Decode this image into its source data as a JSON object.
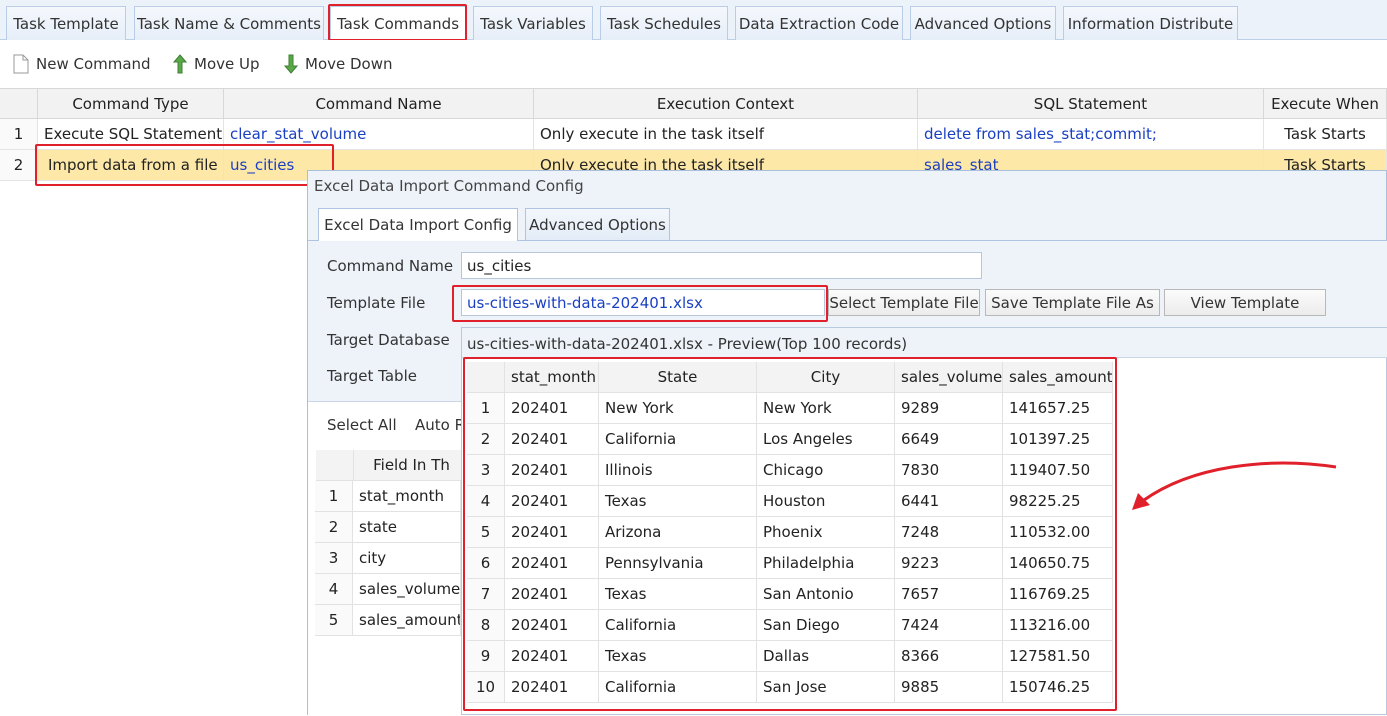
{
  "tabs": [
    {
      "label": "Task Template"
    },
    {
      "label": "Task Name & Comments"
    },
    {
      "label": "Task Commands"
    },
    {
      "label": "Task Variables"
    },
    {
      "label": "Task Schedules"
    },
    {
      "label": "Data Extraction Code"
    },
    {
      "label": "Advanced Options"
    },
    {
      "label": "Information Distribute"
    }
  ],
  "toolbar": {
    "new_command": "New Command",
    "move_up": "Move Up",
    "move_down": "Move Down"
  },
  "commands_grid": {
    "columns": [
      "Command Type",
      "Command Name",
      "Execution Context",
      "SQL Statement",
      "Execute When"
    ],
    "rows": [
      {
        "num": "1",
        "type": "Execute SQL Statements",
        "name": "clear_stat_volume",
        "context": "Only execute in the task itself",
        "sql": "delete from sales_stat;commit;",
        "when": "Task Starts"
      },
      {
        "num": "2",
        "type": "Import data from a file",
        "name": "us_cities",
        "context": "Only execute in the task itself",
        "sql": "sales_stat",
        "when": "Task Starts"
      }
    ]
  },
  "dialog": {
    "title": "Excel Data Import Command Config",
    "tabs": [
      "Excel Data Import Config",
      "Advanced Options"
    ],
    "command_name_label": "Command Name",
    "command_name_value": "us_cities",
    "template_file_label": "Template File",
    "template_file_value": "us-cities-with-data-202401.xlsx",
    "select_template_button": "Select Template File",
    "save_template_button": "Save Template File As",
    "view_template_button": "View Template",
    "target_database_label": "Target Database",
    "target_table_label": "Target Table",
    "select_all": "Select All",
    "auto_partial": "Auto R",
    "field_header_partial": "Field In Th",
    "fields": [
      {
        "num": "1",
        "name": "stat_month"
      },
      {
        "num": "2",
        "name": "state"
      },
      {
        "num": "3",
        "name": "city"
      },
      {
        "num": "4",
        "name": "sales_volume"
      },
      {
        "num": "5",
        "name": "sales_amount"
      }
    ]
  },
  "preview": {
    "title": "us-cities-with-data-202401.xlsx - Preview(Top 100 records)",
    "columns": [
      "stat_month",
      "State",
      "City",
      "sales_volume",
      "sales_amount"
    ],
    "rows": [
      [
        "1",
        "202401",
        "New York",
        "New York",
        "9289",
        "141657.25"
      ],
      [
        "2",
        "202401",
        "California",
        "Los Angeles",
        "6649",
        "101397.25"
      ],
      [
        "3",
        "202401",
        "Illinois",
        "Chicago",
        "7830",
        "119407.50"
      ],
      [
        "4",
        "202401",
        "Texas",
        "Houston",
        "6441",
        "98225.25"
      ],
      [
        "5",
        "202401",
        "Arizona",
        "Phoenix",
        "7248",
        "110532.00"
      ],
      [
        "6",
        "202401",
        "Pennsylvania",
        "Philadelphia",
        "9223",
        "140650.75"
      ],
      [
        "7",
        "202401",
        "Texas",
        "San Antonio",
        "7657",
        "116769.25"
      ],
      [
        "8",
        "202401",
        "California",
        "San Diego",
        "7424",
        "113216.00"
      ],
      [
        "9",
        "202401",
        "Texas",
        "Dallas",
        "8366",
        "127581.50"
      ],
      [
        "10",
        "202401",
        "California",
        "San Jose",
        "9885",
        "150746.25"
      ]
    ]
  },
  "colors": {
    "highlight_box": "#e0202a",
    "link": "#1a3fc2",
    "selected_row": "#fde8a8"
  }
}
